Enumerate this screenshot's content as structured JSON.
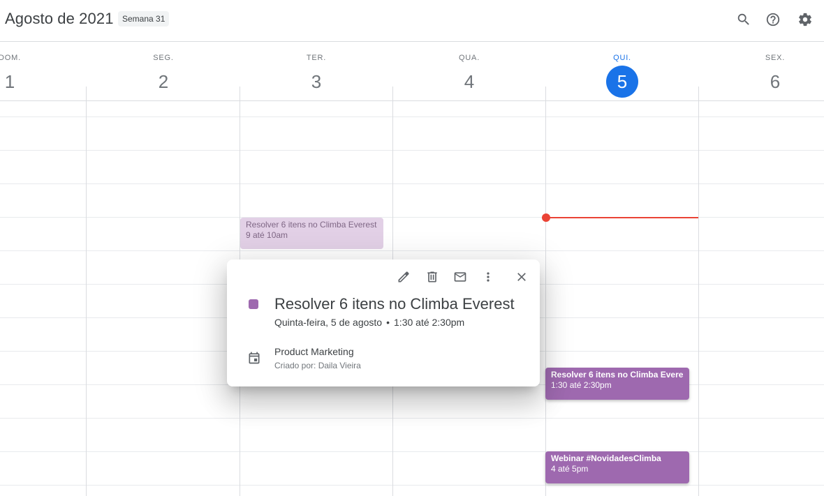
{
  "header": {
    "month_title": "Agosto de 2021",
    "week_badge": "Semana 31",
    "icons": [
      "search-icon",
      "help-icon",
      "settings-icon"
    ]
  },
  "days": [
    {
      "name": "DOM.",
      "num": "1"
    },
    {
      "name": "SEG.",
      "num": "2"
    },
    {
      "name": "TER.",
      "num": "3"
    },
    {
      "name": "QUA.",
      "num": "4"
    },
    {
      "name": "QUI.",
      "num": "5",
      "today": true
    },
    {
      "name": "SEX.",
      "num": "6"
    }
  ],
  "events": {
    "past_event": {
      "title": "Resolver 6 itens no Climba Everest",
      "time": "9 até 10am"
    },
    "selected_event": {
      "title": "Resolver 6 itens no Climba Everest",
      "time": "1:30 até 2:30pm"
    },
    "webinar_event": {
      "title": "Webinar #NovidadesClimba",
      "time": "4 até 5pm"
    }
  },
  "popup": {
    "title": "Resolver 6 itens no Climba Everest",
    "date": "Quinta-feira, 5 de agosto",
    "separator": "•",
    "time": "1:30 até 2:30pm",
    "calendar": "Product Marketing",
    "creator": "Criado por: Daila Vieira",
    "color": "#9e69af",
    "actions": [
      "edit-icon",
      "delete-icon",
      "email-icon",
      "more-options-icon",
      "close-icon"
    ]
  },
  "colors": {
    "accent": "#1a73e8",
    "event": "#9e69af",
    "event_past": "#e2d0e6",
    "now_line": "#ea4335"
  }
}
